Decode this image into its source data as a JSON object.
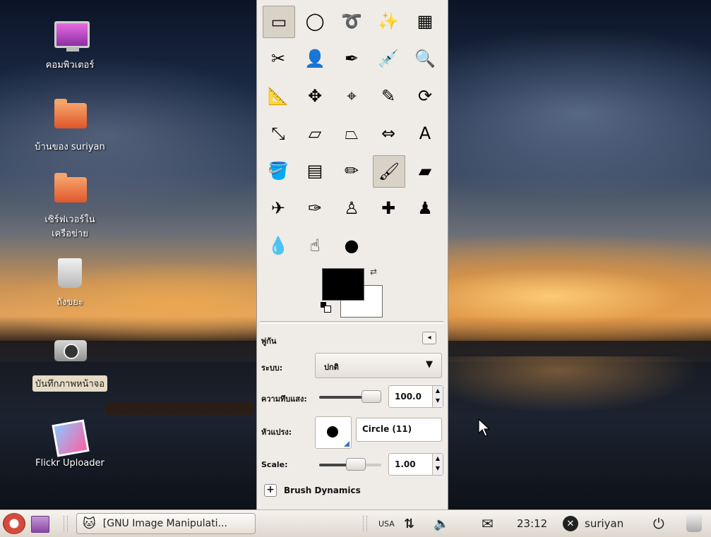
{
  "desktop": {
    "icons": [
      {
        "label": "คอมพิวเตอร์",
        "icon": "computer-icon"
      },
      {
        "label": "บ้านของ suriyan",
        "icon": "home-folder-icon"
      },
      {
        "label": "เซิร์ฟเวอร์ใน\nเครือข่าย",
        "icon": "network-folder-icon"
      },
      {
        "label": "ถังขยะ",
        "icon": "trash-icon"
      },
      {
        "label": "บันทึกภาพหน้าจอ",
        "icon": "camera-icon",
        "selected": true
      },
      {
        "label": "Flickr Uploader",
        "icon": "photos-icon"
      }
    ]
  },
  "toolbox": {
    "tools": [
      {
        "name": "rect-select-icon",
        "glyph": "▭",
        "active": true
      },
      {
        "name": "ellipse-select-icon",
        "glyph": "◯"
      },
      {
        "name": "free-select-icon",
        "glyph": "➰"
      },
      {
        "name": "fuzzy-select-icon",
        "glyph": "✨"
      },
      {
        "name": "select-by-color-icon",
        "glyph": "▦"
      },
      {
        "name": "scissors-select-icon",
        "glyph": "✂"
      },
      {
        "name": "foreground-select-icon",
        "glyph": "👤"
      },
      {
        "name": "paths-icon",
        "glyph": "✒"
      },
      {
        "name": "color-picker-icon",
        "glyph": "💉"
      },
      {
        "name": "zoom-icon",
        "glyph": "🔍"
      },
      {
        "name": "measure-icon",
        "glyph": "📐"
      },
      {
        "name": "move-icon",
        "glyph": "✥"
      },
      {
        "name": "align-icon",
        "glyph": "⌖"
      },
      {
        "name": "crop-icon",
        "glyph": "✎"
      },
      {
        "name": "rotate-icon",
        "glyph": "⟳"
      },
      {
        "name": "scale-icon",
        "glyph": "⤡"
      },
      {
        "name": "shear-icon",
        "glyph": "▱"
      },
      {
        "name": "perspective-icon",
        "glyph": "⏢"
      },
      {
        "name": "flip-icon",
        "glyph": "⇔"
      },
      {
        "name": "text-icon",
        "glyph": "A"
      },
      {
        "name": "bucket-fill-icon",
        "glyph": "🪣"
      },
      {
        "name": "blend-icon",
        "glyph": "▤"
      },
      {
        "name": "pencil-icon",
        "glyph": "✏"
      },
      {
        "name": "paintbrush-icon",
        "glyph": "🖌",
        "active": true
      },
      {
        "name": "eraser-icon",
        "glyph": "▰"
      },
      {
        "name": "airbrush-icon",
        "glyph": "✈"
      },
      {
        "name": "ink-icon",
        "glyph": "✑"
      },
      {
        "name": "clone-icon",
        "glyph": "♙"
      },
      {
        "name": "heal-icon",
        "glyph": "✚"
      },
      {
        "name": "perspective-clone-icon",
        "glyph": "♟"
      },
      {
        "name": "blur-icon",
        "glyph": "💧"
      },
      {
        "name": "smudge-icon",
        "glyph": "☝"
      },
      {
        "name": "dodge-burn-icon",
        "glyph": "●"
      }
    ],
    "colors": {
      "foreground": "#000000",
      "background": "#ffffff"
    }
  },
  "tool_options": {
    "title": "พู่กัน",
    "mode_label": "ระบบ:",
    "mode_value": "ปกติ",
    "opacity_label": "ความทึบแสง:",
    "opacity_value": "100.0",
    "opacity_fraction": 1.0,
    "brush_label": "หัวแปรง:",
    "brush_value": "Circle (11)",
    "scale_label": "Scale:",
    "scale_value": "1.00",
    "scale_fraction": 0.55,
    "dynamics_label": "Brush Dynamics"
  },
  "taskbar": {
    "task_label": "[GNU Image Manipulati...",
    "keyboard_layout": "USA",
    "clock": "23:12",
    "username": "suriyan"
  }
}
